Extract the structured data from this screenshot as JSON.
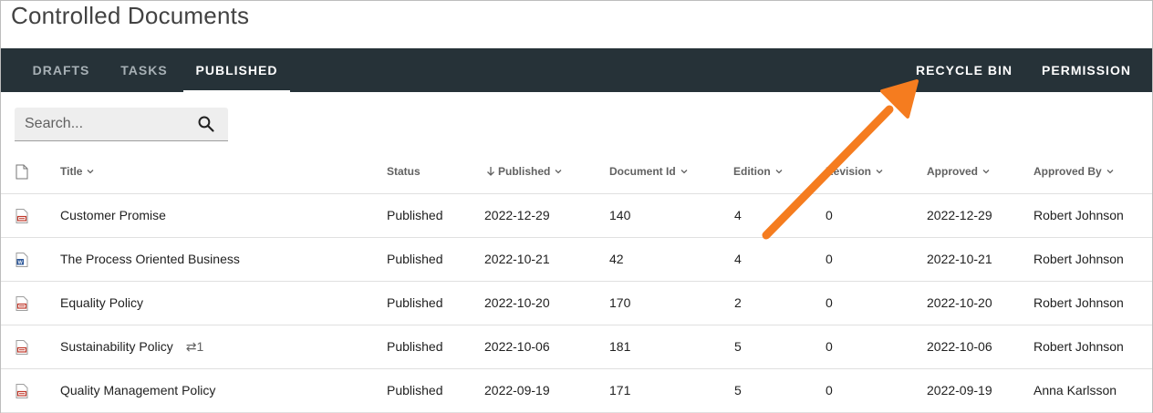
{
  "page": {
    "title": "Controlled Documents"
  },
  "tabs": {
    "drafts": "DRAFTS",
    "tasks": "TASKS",
    "published": "PUBLISHED",
    "recycle_bin": "RECYCLE BIN",
    "permission": "PERMISSION"
  },
  "search": {
    "placeholder": "Search...",
    "icon": "search-icon"
  },
  "table": {
    "columns": {
      "title": "Title",
      "status": "Status",
      "published": "Published",
      "document_id": "Document Id",
      "edition": "Edition",
      "revision": "Revision",
      "approved": "Approved",
      "approved_by": "Approved By"
    },
    "sorted_column": "published",
    "sort_direction": "descending",
    "rows": [
      {
        "type": "pdf",
        "title": "Customer Promise",
        "link_count": "",
        "status": "Published",
        "published": "2022-12-29",
        "document_id": "140",
        "edition": "4",
        "revision": "0",
        "approved": "2022-12-29",
        "approved_by": "Robert Johnson"
      },
      {
        "type": "word",
        "title": "The Process Oriented Business",
        "link_count": "",
        "status": "Published",
        "published": "2022-10-21",
        "document_id": "42",
        "edition": "4",
        "revision": "0",
        "approved": "2022-10-21",
        "approved_by": "Robert Johnson"
      },
      {
        "type": "pdf",
        "title": "Equality Policy",
        "link_count": "",
        "status": "Published",
        "published": "2022-10-20",
        "document_id": "170",
        "edition": "2",
        "revision": "0",
        "approved": "2022-10-20",
        "approved_by": "Robert Johnson"
      },
      {
        "type": "pdf",
        "title": "Sustainability Policy",
        "link_count": "⇄1",
        "status": "Published",
        "published": "2022-10-06",
        "document_id": "181",
        "edition": "5",
        "revision": "0",
        "approved": "2022-10-06",
        "approved_by": "Robert Johnson"
      },
      {
        "type": "pdf",
        "title": "Quality Management Policy",
        "link_count": "",
        "status": "Published",
        "published": "2022-09-19",
        "document_id": "171",
        "edition": "5",
        "revision": "0",
        "approved": "2022-09-19",
        "approved_by": "Anna Karlsson"
      }
    ]
  },
  "colors": {
    "tabbar": "#263238",
    "annotation_arrow": "#f57c1f",
    "pdf_icon": "#c0392b",
    "word_icon": "#2b579a"
  }
}
